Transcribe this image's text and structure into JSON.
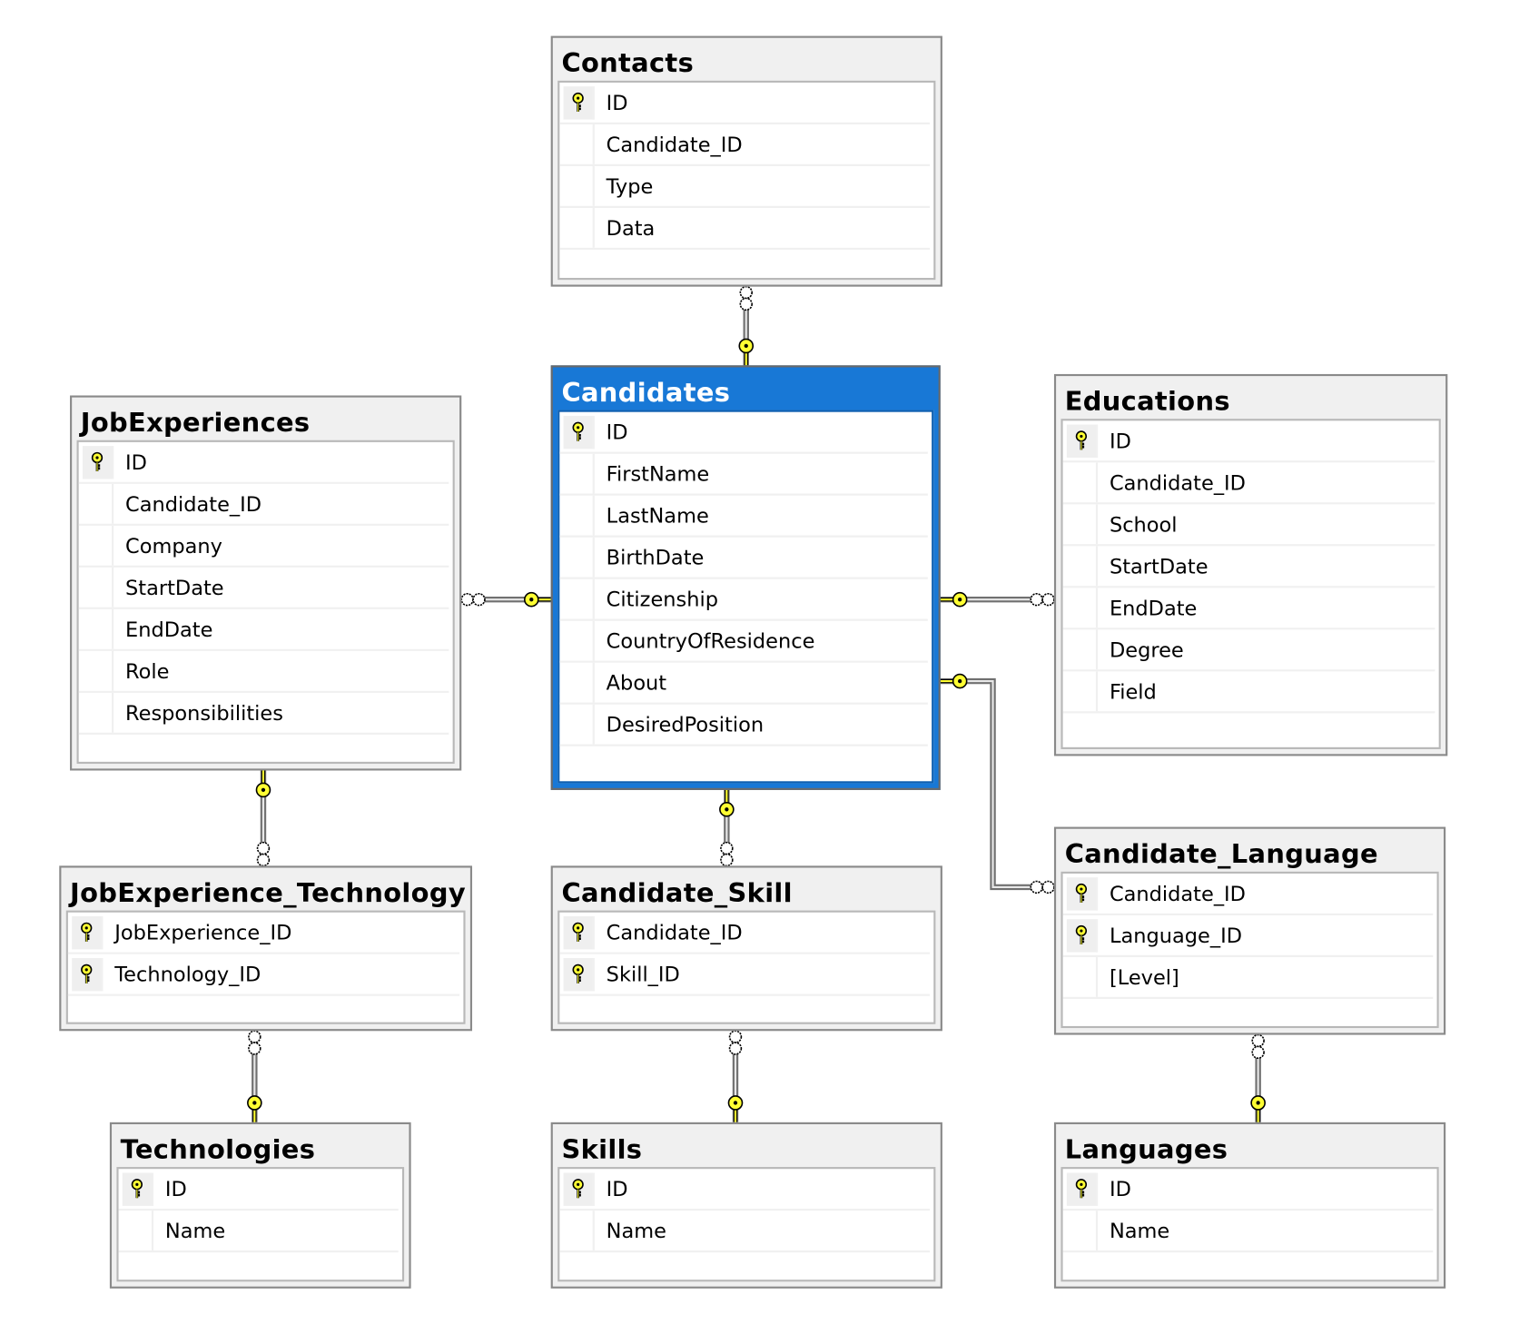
{
  "diagram": {
    "colors": {
      "selected_header": "#1878d6",
      "key": "#ffff33",
      "line": "#a0a0a0"
    },
    "tables": [
      {
        "name": "Contacts",
        "selected": false,
        "columns": [
          {
            "name": "ID",
            "pk": true
          },
          {
            "name": "Candidate_ID",
            "pk": false
          },
          {
            "name": "Type",
            "pk": false
          },
          {
            "name": "Data",
            "pk": false
          }
        ]
      },
      {
        "name": "Candidates",
        "selected": true,
        "columns": [
          {
            "name": "ID",
            "pk": true
          },
          {
            "name": "FirstName",
            "pk": false
          },
          {
            "name": "LastName",
            "pk": false
          },
          {
            "name": "BirthDate",
            "pk": false
          },
          {
            "name": "Citizenship",
            "pk": false
          },
          {
            "name": "CountryOfResidence",
            "pk": false
          },
          {
            "name": "About",
            "pk": false
          },
          {
            "name": "DesiredPosition",
            "pk": false
          }
        ]
      },
      {
        "name": "JobExperiences",
        "selected": false,
        "columns": [
          {
            "name": "ID",
            "pk": true
          },
          {
            "name": "Candidate_ID",
            "pk": false
          },
          {
            "name": "Company",
            "pk": false
          },
          {
            "name": "StartDate",
            "pk": false
          },
          {
            "name": "EndDate",
            "pk": false
          },
          {
            "name": "Role",
            "pk": false
          },
          {
            "name": "Responsibilities",
            "pk": false
          }
        ]
      },
      {
        "name": "Educations",
        "selected": false,
        "columns": [
          {
            "name": "ID",
            "pk": true
          },
          {
            "name": "Candidate_ID",
            "pk": false
          },
          {
            "name": "School",
            "pk": false
          },
          {
            "name": "StartDate",
            "pk": false
          },
          {
            "name": "EndDate",
            "pk": false
          },
          {
            "name": "Degree",
            "pk": false
          },
          {
            "name": "Field",
            "pk": false
          }
        ]
      },
      {
        "name": "JobExperience_Technology",
        "selected": false,
        "columns": [
          {
            "name": "JobExperience_ID",
            "pk": true
          },
          {
            "name": "Technology_ID",
            "pk": true
          }
        ]
      },
      {
        "name": "Candidate_Skill",
        "selected": false,
        "columns": [
          {
            "name": "Candidate_ID",
            "pk": true
          },
          {
            "name": "Skill_ID",
            "pk": true
          }
        ]
      },
      {
        "name": "Candidate_Language",
        "selected": false,
        "columns": [
          {
            "name": "Candidate_ID",
            "pk": true
          },
          {
            "name": "Language_ID",
            "pk": true
          },
          {
            "name": "[Level]",
            "pk": false
          }
        ]
      },
      {
        "name": "Technologies",
        "selected": false,
        "columns": [
          {
            "name": "ID",
            "pk": true
          },
          {
            "name": "Name",
            "pk": false
          }
        ]
      },
      {
        "name": "Skills",
        "selected": false,
        "columns": [
          {
            "name": "ID",
            "pk": true
          },
          {
            "name": "Name",
            "pk": false
          }
        ]
      },
      {
        "name": "Languages",
        "selected": false,
        "columns": [
          {
            "name": "ID",
            "pk": true
          },
          {
            "name": "Name",
            "pk": false
          }
        ]
      }
    ],
    "relationships": [
      {
        "one": "Candidates",
        "many": "Contacts"
      },
      {
        "one": "Candidates",
        "many": "JobExperiences"
      },
      {
        "one": "Candidates",
        "many": "Educations"
      },
      {
        "one": "Candidates",
        "many": "Candidate_Language"
      },
      {
        "one": "JobExperiences",
        "many": "JobExperience_Technology"
      },
      {
        "one": "Candidates",
        "many": "Candidate_Skill"
      },
      {
        "one": "Technologies",
        "many": "JobExperience_Technology"
      },
      {
        "one": "Skills",
        "many": "Candidate_Skill"
      },
      {
        "one": "Languages",
        "many": "Candidate_Language"
      }
    ]
  }
}
